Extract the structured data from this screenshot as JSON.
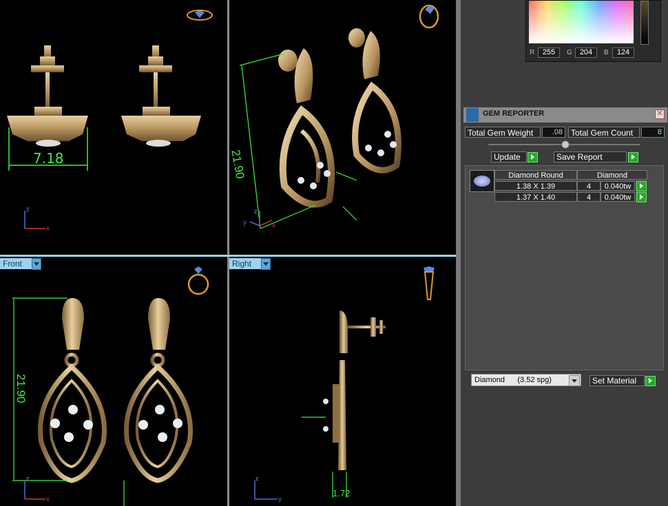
{
  "viewports": {
    "top_left": {
      "dimension": "7.18"
    },
    "top_right": {
      "dimension": "21.90"
    },
    "bottom_left": {
      "tab": "Front",
      "dimension": "21.90"
    },
    "bottom_right": {
      "tab": "Right",
      "dimension": "1.72"
    }
  },
  "color_picker": {
    "r_label": "R",
    "r_value": "255",
    "g_label": "G",
    "g_value": "204",
    "b_label": "B",
    "b_value": "124"
  },
  "gem_reporter": {
    "title": "GEM REPORTER",
    "total_weight_label": "Total Gem Weight",
    "total_weight_value": ".08",
    "total_count_label": "Total Gem Count",
    "total_count_value": "8",
    "update_label": "Update",
    "save_label": "Save Report",
    "table": {
      "headers": [
        "Diamond Round",
        "Diamond"
      ],
      "rows": [
        {
          "size": "1.38 X 1.39",
          "count": "4",
          "weight": "0.040tw"
        },
        {
          "size": "1.37 X 1.40",
          "count": "4",
          "weight": "0.040tw"
        }
      ]
    },
    "material_select": "Diamond      (3.52 spg)",
    "set_material_label": "Set Material"
  },
  "colors": {
    "accent_green": "#27a82a",
    "dimension_green": "#3cf23c",
    "gold": "#c9ad7f",
    "tab_blue": "#9fd2f0"
  }
}
